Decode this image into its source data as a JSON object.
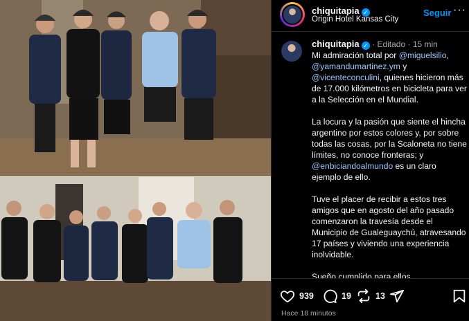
{
  "post": {
    "username": "chiquitapia",
    "location": "Origin Hotel Kansas City",
    "follow_label": "Seguir",
    "more_label": "···",
    "edited_label": "Editado",
    "age": "15 min",
    "caption": {
      "p1_before": "Mi admiración total por ",
      "mention1": "@miguelsilio",
      "p1_sep": ",",
      "mention2": "@yamandumartinez.ym",
      "p1_and": " y ",
      "mention3": "@vicenteconculini",
      "p1_after": ", quienes hicieron más de 17.000 kilómetros en bicicleta para ver a la Selección en el Mundial.",
      "p2_before": "La locura y la pasión que siente el hincha argentino por estos colores y, por sobre todas las cosas, por la Scaloneta no tiene límites, no conoce fronteras; y ",
      "mention4": "@enbiciandoalmundo",
      "p2_after": " es un claro ejemplo de ello.",
      "p3": "Tuve el placer de recibir a estos tres amigos que en agosto del año pasado comenzaron la travesía desde el Municipio de Gualeguaychú, atravesando 17 países y viviendo una experiencia inolvidable.",
      "p4": "Sueño cumplido para ellos..."
    },
    "likes": "939",
    "comments": "19",
    "reposts": "13",
    "time_ago": "Hace 18 minutos"
  },
  "colors": {
    "accent": "#0095f6",
    "background": "#000000",
    "muted": "#a8a8a8"
  }
}
